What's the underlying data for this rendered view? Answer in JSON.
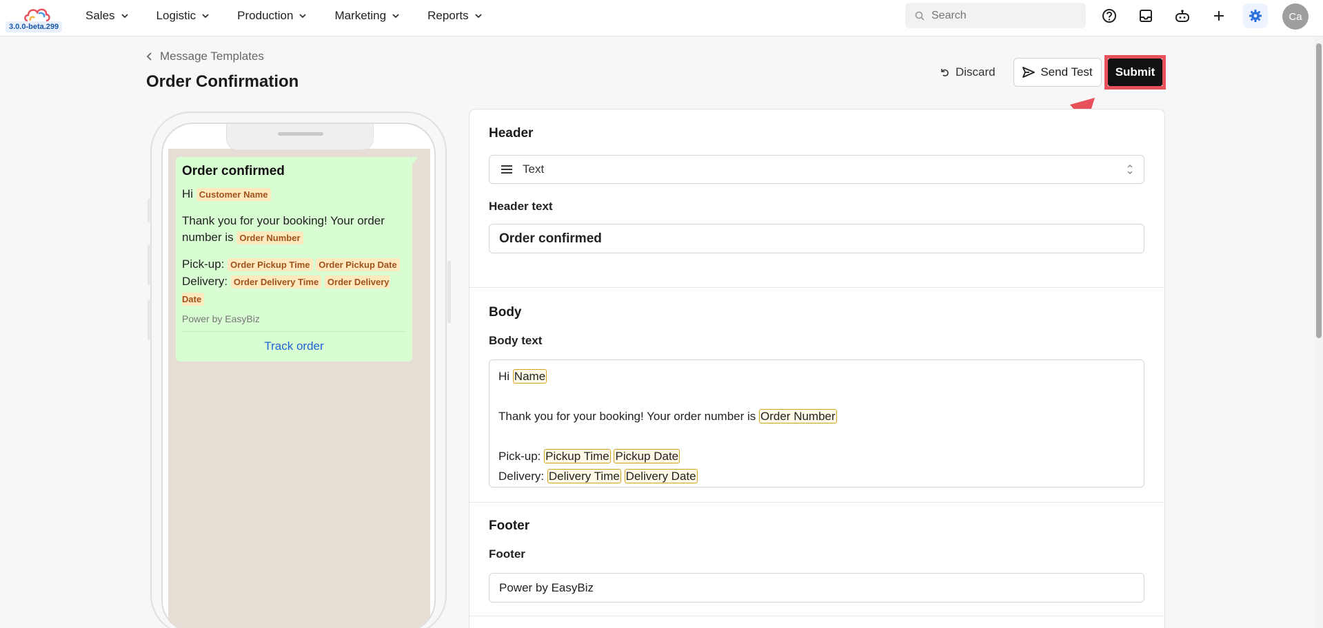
{
  "app": {
    "version": "3.0.0-beta.299",
    "brand_colors": [
      "#e8505b",
      "#f4b23a",
      "#4a9be8"
    ]
  },
  "nav": {
    "items": [
      "Sales",
      "Logistic",
      "Production",
      "Marketing",
      "Reports"
    ]
  },
  "search": {
    "placeholder": "Search"
  },
  "toolbar_icons": [
    "help-icon",
    "inbox-icon",
    "bot-icon",
    "plus-icon",
    "settings-icon"
  ],
  "user": {
    "initials": "Ca"
  },
  "page": {
    "breadcrumb": "Message Templates",
    "title": "Order Confirmation",
    "discard_label": "Discard",
    "send_test_label": "Send Test",
    "submit_label": "Submit"
  },
  "preview": {
    "title": "Order confirmed",
    "greeting": "Hi",
    "customer_chip": "Customer Name",
    "thanks_text": "Thank you for your booking! Your order number is",
    "order_chip": "Order Number",
    "pickup_label": "Pick-up:",
    "pickup_time_chip": "Order Pickup Time",
    "pickup_date_chip": "Order Pickup Date",
    "delivery_label": "Delivery:",
    "delivery_time_chip": "Order Delivery Time",
    "delivery_date_chip": "Order Delivery Date",
    "footer": "Power by EasyBiz",
    "button": "Track order"
  },
  "form": {
    "header": {
      "section_title": "Header",
      "type_value": "Text",
      "text_label": "Header text",
      "text_value": "Order confirmed"
    },
    "body": {
      "section_title": "Body",
      "text_label": "Body text",
      "greeting": "Hi",
      "name_tag": "Name",
      "thanks_text": "Thank you for your booking! Your order number is",
      "order_tag": "Order Number",
      "pickup_label": "Pick-up:",
      "pickup_time_tag": "Pickup Time",
      "pickup_date_tag": "Pickup Date",
      "delivery_label": "Delivery:",
      "delivery_time_tag": "Delivery Time",
      "delivery_date_tag": "Delivery Date"
    },
    "footer": {
      "section_title": "Footer",
      "label": "Footer",
      "value": "Power by EasyBiz"
    }
  }
}
